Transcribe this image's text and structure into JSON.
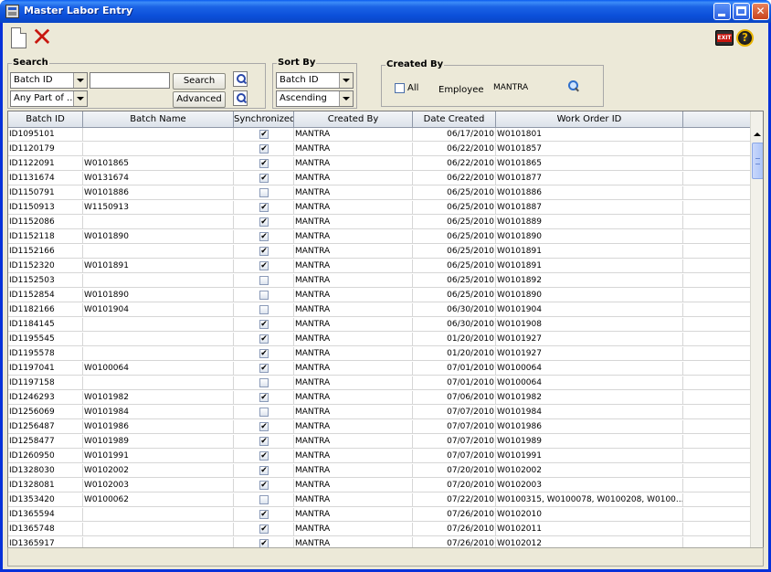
{
  "window": {
    "title": "Master Labor Entry"
  },
  "toolbar": {
    "new_icon": "new-document-icon",
    "delete_icon": "delete-x-icon",
    "exit_icon": "exit-icon",
    "exit_label": "EXIT",
    "help_icon": "help-icon",
    "help_glyph": "?"
  },
  "search": {
    "title": "Search",
    "field_select": "Batch ID",
    "match_select": "Any Part of ...",
    "input_value": "",
    "search_button": "Search",
    "advanced_button": "Advanced"
  },
  "sort": {
    "title": "Sort By",
    "field_select": "Batch ID",
    "order_select": "Ascending"
  },
  "created_by": {
    "title": "Created By",
    "all_label": "All",
    "employee_label": "Employee",
    "employee_value": "MANTRA"
  },
  "table": {
    "columns": [
      "Batch ID",
      "Batch Name",
      "Synchronized",
      "Created By",
      "Date Created",
      "Work Order ID"
    ],
    "rows": [
      [
        "ID1095101",
        "",
        true,
        "MANTRA",
        "06/17/2010",
        "W0101801"
      ],
      [
        "ID1120179",
        "",
        true,
        "MANTRA",
        "06/22/2010",
        "W0101857"
      ],
      [
        "ID1122091",
        "W0101865",
        true,
        "MANTRA",
        "06/22/2010",
        "W0101865"
      ],
      [
        "ID1131674",
        "W0131674",
        true,
        "MANTRA",
        "06/22/2010",
        "W0101877"
      ],
      [
        "ID1150791",
        "W0101886",
        false,
        "MANTRA",
        "06/25/2010",
        "W0101886"
      ],
      [
        "ID1150913",
        "W1150913",
        true,
        "MANTRA",
        "06/25/2010",
        "W0101887"
      ],
      [
        "ID1152086",
        "",
        true,
        "MANTRA",
        "06/25/2010",
        "W0101889"
      ],
      [
        "ID1152118",
        "W0101890",
        true,
        "MANTRA",
        "06/25/2010",
        "W0101890"
      ],
      [
        "ID1152166",
        "",
        true,
        "MANTRA",
        "06/25/2010",
        "W0101891"
      ],
      [
        "ID1152320",
        "W0101891",
        true,
        "MANTRA",
        "06/25/2010",
        "W0101891"
      ],
      [
        "ID1152503",
        "",
        false,
        "MANTRA",
        "06/25/2010",
        "W0101892"
      ],
      [
        "ID1152854",
        "W0101890",
        false,
        "MANTRA",
        "06/25/2010",
        "W0101890"
      ],
      [
        "ID1182166",
        "W0101904",
        false,
        "MANTRA",
        "06/30/2010",
        "W0101904"
      ],
      [
        "ID1184145",
        "",
        true,
        "MANTRA",
        "06/30/2010",
        "W0101908"
      ],
      [
        "ID1195545",
        "",
        true,
        "MANTRA",
        "01/20/2010",
        "W0101927"
      ],
      [
        "ID1195578",
        "",
        true,
        "MANTRA",
        "01/20/2010",
        "W0101927"
      ],
      [
        "ID1197041",
        "W0100064",
        true,
        "MANTRA",
        "07/01/2010",
        "W0100064"
      ],
      [
        "ID1197158",
        "",
        false,
        "MANTRA",
        "07/01/2010",
        "W0100064"
      ],
      [
        "ID1246293",
        "W0101982",
        true,
        "MANTRA",
        "07/06/2010",
        "W0101982"
      ],
      [
        "ID1256069",
        "W0101984",
        false,
        "MANTRA",
        "07/07/2010",
        "W0101984"
      ],
      [
        "ID1256487",
        "W0101986",
        true,
        "MANTRA",
        "07/07/2010",
        "W0101986"
      ],
      [
        "ID1258477",
        "W0101989",
        true,
        "MANTRA",
        "07/07/2010",
        "W0101989"
      ],
      [
        "ID1260950",
        "W0101991",
        true,
        "MANTRA",
        "07/07/2010",
        "W0101991"
      ],
      [
        "ID1328030",
        "W0102002",
        true,
        "MANTRA",
        "07/20/2010",
        "W0102002"
      ],
      [
        "ID1328081",
        "W0102003",
        true,
        "MANTRA",
        "07/20/2010",
        "W0102003"
      ],
      [
        "ID1353420",
        "W0100062",
        false,
        "MANTRA",
        "07/22/2010",
        "W0100315, W0100078, W0100208, W0100..."
      ],
      [
        "ID1365594",
        "",
        true,
        "MANTRA",
        "07/26/2010",
        "W0102010"
      ],
      [
        "ID1365748",
        "",
        true,
        "MANTRA",
        "07/26/2010",
        "W0102011"
      ],
      [
        "ID1365917",
        "",
        true,
        "MANTRA",
        "07/26/2010",
        "W0102012"
      ]
    ]
  },
  "status": {
    "text": ""
  }
}
